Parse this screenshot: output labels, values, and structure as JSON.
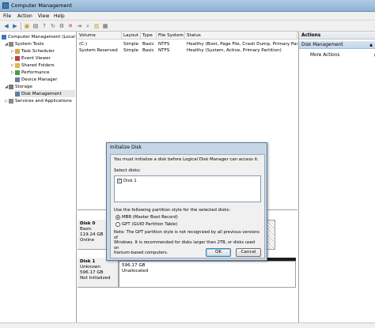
{
  "window": {
    "title": "Computer Management"
  },
  "menu": [
    "File",
    "Action",
    "View",
    "Help"
  ],
  "toolbar": {
    "icons": [
      "back-arrow-icon",
      "forward-arrow-icon",
      "up-folder-icon",
      "properties-icon",
      "help-icon",
      "refresh-icon",
      "settings-icon",
      "delete-icon",
      "export-icon",
      "search-icon",
      "open-folder-icon",
      "action-icon"
    ]
  },
  "tree": {
    "root": "Computer Management (Local",
    "system_tools": "System Tools",
    "task_scheduler": "Task Scheduler",
    "event_viewer": "Event Viewer",
    "shared_folders": "Shared Folders",
    "performance": "Performance",
    "device_manager": "Device Manager",
    "storage": "Storage",
    "disk_management": "Disk Management",
    "services": "Services and Applications"
  },
  "volumes": {
    "headers": [
      "Volume",
      "Layout",
      "Type",
      "File System",
      "Status"
    ],
    "rows": [
      [
        "(C:)",
        "Simple",
        "Basic",
        "NTFS",
        "Healthy (Boot, Page File, Crash Dump, Primary Partitio"
      ],
      [
        "System Reserved",
        "Simple",
        "Basic",
        "NTFS",
        "Healthy (System, Active, Primary Partition)"
      ]
    ]
  },
  "disks": {
    "disk0": {
      "name": "Disk 0",
      "type": "Basic",
      "size": "119.24 GB",
      "state": "Online"
    },
    "disk1": {
      "name": "Disk 1",
      "type": "Unknown",
      "size": "596.17 GB",
      "state": "Not Initialized",
      "part_size": "596.17 GB",
      "part_state": "Unallocated"
    }
  },
  "actions": {
    "header": "Actions",
    "section": "Disk Management",
    "more": "More Actions"
  },
  "dialog": {
    "title": "Initialize Disk",
    "intro": "You must initialize a disk before Logical Disk Manager can access it.",
    "select_label": "Select disks:",
    "disk_item": "Disk 1",
    "style_label": "Use the following partition style for the selected disks:",
    "mbr": "MBR (Master Boot Record)",
    "gpt": "GPT (GUID Partition Table)",
    "note_lines": [
      "Note: The GPT partition style is not recognized by all previous versions of",
      "Windows. It is recommended for disks larger than 2TB, or disks used on",
      "Itanium-based computers."
    ],
    "ok": "OK",
    "cancel": "Cancel"
  },
  "colors": {
    "titlebar": "#aecbe4",
    "selection": "#c3d6ea",
    "unallocated_bar": "#1c1c1c"
  }
}
